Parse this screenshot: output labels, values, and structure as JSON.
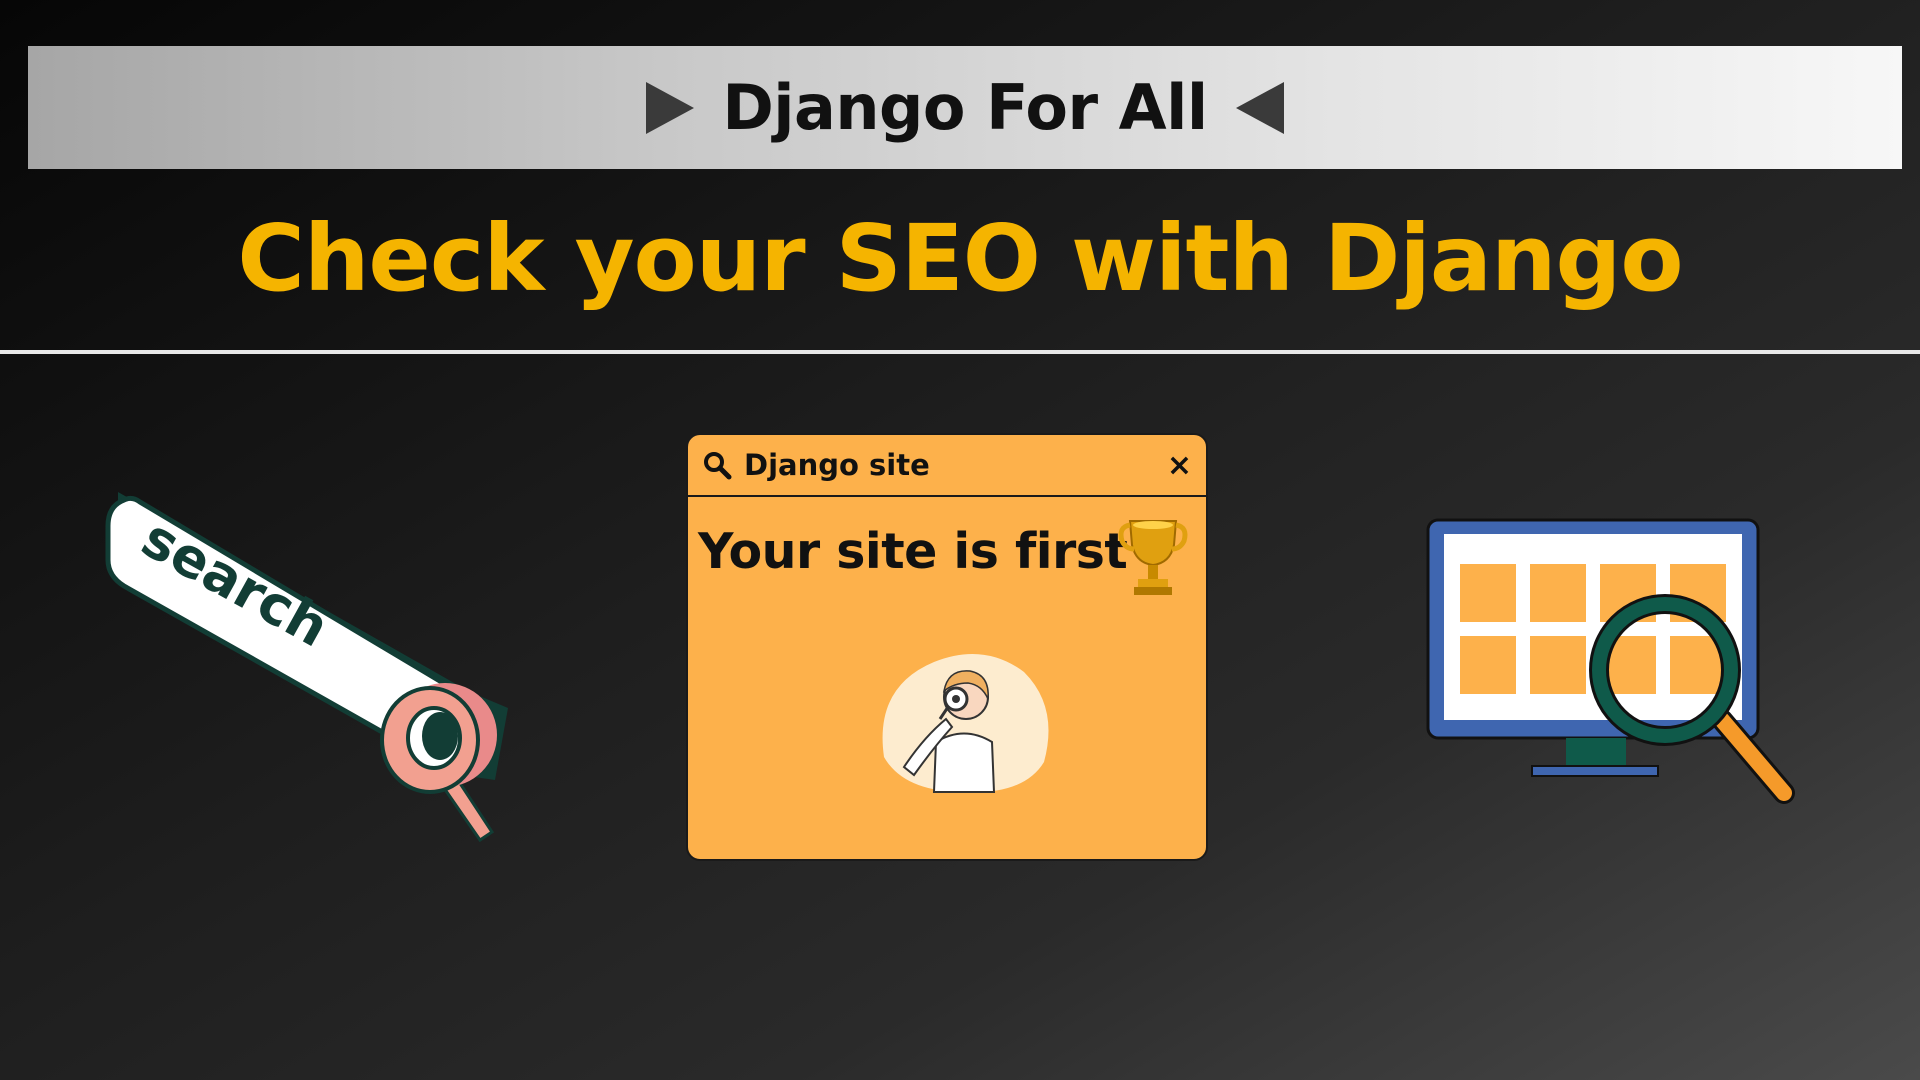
{
  "banner": {
    "title": "Django For All"
  },
  "headline": "Check your SEO with Django",
  "left_art": {
    "word": "search",
    "icon": "magnifier-search-bar-icon"
  },
  "window": {
    "title": "Django site",
    "close_symbol": "×",
    "message": "Your site is first",
    "icons": [
      "search-icon",
      "close-icon",
      "trophy-icon",
      "person-with-magnifier-icon"
    ]
  },
  "right_art": {
    "icon": "monitor-magnifier-icon"
  },
  "colors": {
    "headline": "#f5b400",
    "window_bg": "#fdb14b",
    "monitor_frame": "#3f66b0",
    "dark_green": "#0f5a4a",
    "pink": "#f2a090"
  }
}
